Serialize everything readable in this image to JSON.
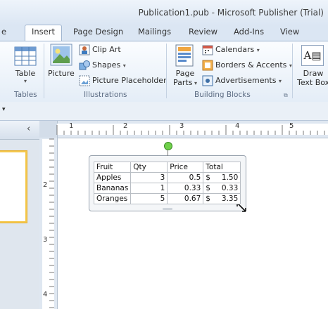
{
  "window": {
    "title": "Publication1.pub - Microsoft Publisher (Trial)"
  },
  "tabs": [
    {
      "label": "e"
    },
    {
      "label": "Insert"
    },
    {
      "label": "Page Design"
    },
    {
      "label": "Mailings"
    },
    {
      "label": "Review"
    },
    {
      "label": "Add-Ins"
    },
    {
      "label": "View"
    }
  ],
  "ribbon": {
    "tables": {
      "group_label": "Tables",
      "table_label": "Table"
    },
    "illustrations": {
      "group_label": "Illustrations",
      "picture_label": "Picture",
      "clip_art_label": "Clip Art",
      "shapes_label": "Shapes",
      "picture_placeholder_label": "Picture Placeholder"
    },
    "building_blocks": {
      "group_label": "Building Blocks",
      "page_label": "Page",
      "parts_label": "Parts",
      "calendars_label": "Calendars",
      "borders_label": "Borders & Accents",
      "ads_label": "Advertisements"
    },
    "text": {
      "draw_label": "Draw",
      "text_box_label": "Text Box"
    }
  },
  "page_thumbnails": {
    "collapse_glyph": "‹"
  },
  "rulers": {
    "horizontal_numbers": [
      "1",
      "2",
      "3",
      "4",
      "5"
    ],
    "vertical_numbers": [
      "2",
      "3",
      "4"
    ]
  },
  "table": {
    "headers": [
      "Fruit",
      "Qty",
      "Price",
      "Total"
    ],
    "rows": [
      [
        "Apples",
        "3",
        "0.5",
        "$",
        "1.50"
      ],
      [
        "Bananas",
        "1",
        "0.33",
        "$",
        "0.33"
      ],
      [
        "Oranges",
        "5",
        "0.67",
        "$",
        "3.35"
      ]
    ]
  }
}
